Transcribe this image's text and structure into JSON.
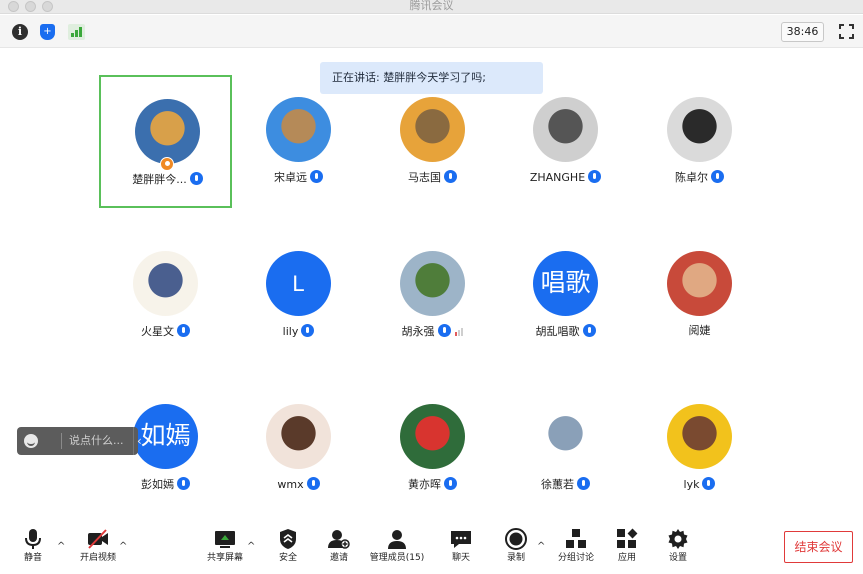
{
  "window": {
    "title": "腾讯会议"
  },
  "topbar": {
    "timer": "38:46"
  },
  "speaking": {
    "text": "正在讲话: 楚胖胖今天学习了吗;"
  },
  "participants": [
    {
      "name": "楚胖胖今...",
      "avatar_type": "photo",
      "avatar_colors": [
        "#3b6fae",
        "#d8a04a"
      ],
      "active": true,
      "host": true
    },
    {
      "name": "宋卓远",
      "avatar_type": "photo",
      "avatar_colors": [
        "#3d8de0",
        "#b58a58"
      ]
    },
    {
      "name": "马志国",
      "avatar_type": "photo",
      "avatar_colors": [
        "#e7a33a",
        "#8a6a40"
      ]
    },
    {
      "name": "ZHANGHE",
      "avatar_type": "photo",
      "avatar_colors": [
        "#cfcfcf",
        "#555555"
      ]
    },
    {
      "name": "陈卓尔",
      "avatar_type": "photo",
      "avatar_colors": [
        "#dadada",
        "#2a2a2a"
      ]
    },
    {
      "name": "火星文",
      "avatar_type": "photo",
      "avatar_colors": [
        "#f7f3ea",
        "#4a5f8f"
      ]
    },
    {
      "name": "lily",
      "avatar_type": "letter",
      "letter": "L"
    },
    {
      "name": "胡永强",
      "avatar_type": "photo",
      "avatar_colors": [
        "#9db4c8",
        "#4f7d3a"
      ],
      "weak_signal": true
    },
    {
      "name": "胡乱唱歌",
      "avatar_type": "letter",
      "letter": "唱歌"
    },
    {
      "name": "阅婕",
      "avatar_type": "photo",
      "avatar_colors": [
        "#c84a3a",
        "#e0a882"
      ],
      "no_mic": true
    },
    {
      "name": "彭如嫣",
      "avatar_type": "letter",
      "letter": "如嫣"
    },
    {
      "name": "wmx",
      "avatar_type": "photo",
      "avatar_colors": [
        "#f1e3da",
        "#5a3a2a"
      ]
    },
    {
      "name": "黄亦晖",
      "avatar_type": "photo",
      "avatar_colors": [
        "#2f6c3a",
        "#d8342f"
      ]
    },
    {
      "name": "徐蕙若",
      "avatar_type": "photo",
      "avatar_colors": [
        "#ffffff",
        "#8aa0b8"
      ]
    },
    {
      "name": "lyk",
      "avatar_type": "photo",
      "avatar_colors": [
        "#f2c21c",
        "#7a4a30"
      ]
    }
  ],
  "chat": {
    "placeholder": "说点什么..."
  },
  "toolbar": {
    "mute": "静音",
    "video": "开启视频",
    "share": "共享屏幕",
    "security": "安全",
    "invite": "邀请",
    "members": "管理成员(15)",
    "chat": "聊天",
    "record": "录制",
    "breakout": "分组讨论",
    "apps": "应用",
    "settings": "设置",
    "end": "结束会议"
  },
  "colors": {
    "accent": "#1a6df0",
    "active_border": "#5ac05a",
    "end": "#e03a3a"
  }
}
